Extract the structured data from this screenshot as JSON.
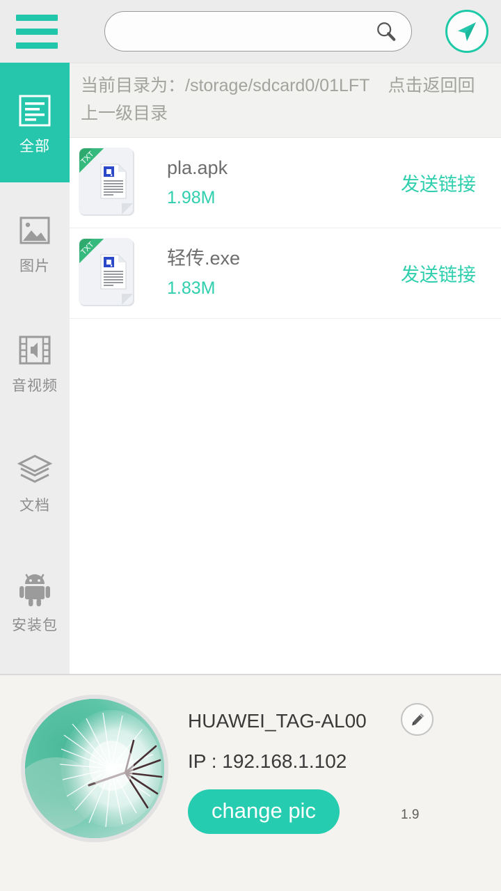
{
  "topbar": {
    "menu_icon": "hamburger-menu-icon",
    "search": {
      "value": "",
      "placeholder": "",
      "icon": "search-icon"
    },
    "send_icon": "paper-plane-icon"
  },
  "sidebar": {
    "items": [
      {
        "label": "全部",
        "icon": "list-document-icon",
        "active": true
      },
      {
        "label": "图片",
        "icon": "image-icon",
        "active": false
      },
      {
        "label": "音视频",
        "icon": "media-film-speaker-icon",
        "active": false
      },
      {
        "label": "文档",
        "icon": "layers-stack-icon",
        "active": false
      },
      {
        "label": "安装包",
        "icon": "android-robot-icon",
        "active": false
      }
    ]
  },
  "main": {
    "path_prefix": "当前目录为：",
    "path_value": "/storage/sdcard0/01LFT",
    "path_hint": "点击返回回上一级目录",
    "files": [
      {
        "name": "pla.apk",
        "size": "1.98M",
        "action": "发送链接",
        "icon": "txt-file-icon",
        "badge": "TXT"
      },
      {
        "name": "轻传.exe",
        "size": "1.83M",
        "action": "发送链接",
        "icon": "txt-file-icon",
        "badge": "TXT"
      }
    ]
  },
  "bottom": {
    "avatar_icon": "dandelion-avatar",
    "device_name": "HUAWEI_TAG-AL00",
    "ip": "IP : 192.168.1.102",
    "change_pic_label": "change pic",
    "edit_icon": "pencil-edit-icon",
    "version": "1.9"
  },
  "colors": {
    "accent": "#25c6ab",
    "accent_text": "#2fcfae",
    "sidebar_bg": "#ededed",
    "topbar_bg": "#ececec",
    "bottom_bg": "#f4f3ef",
    "path_bg": "#f2f2f0"
  }
}
